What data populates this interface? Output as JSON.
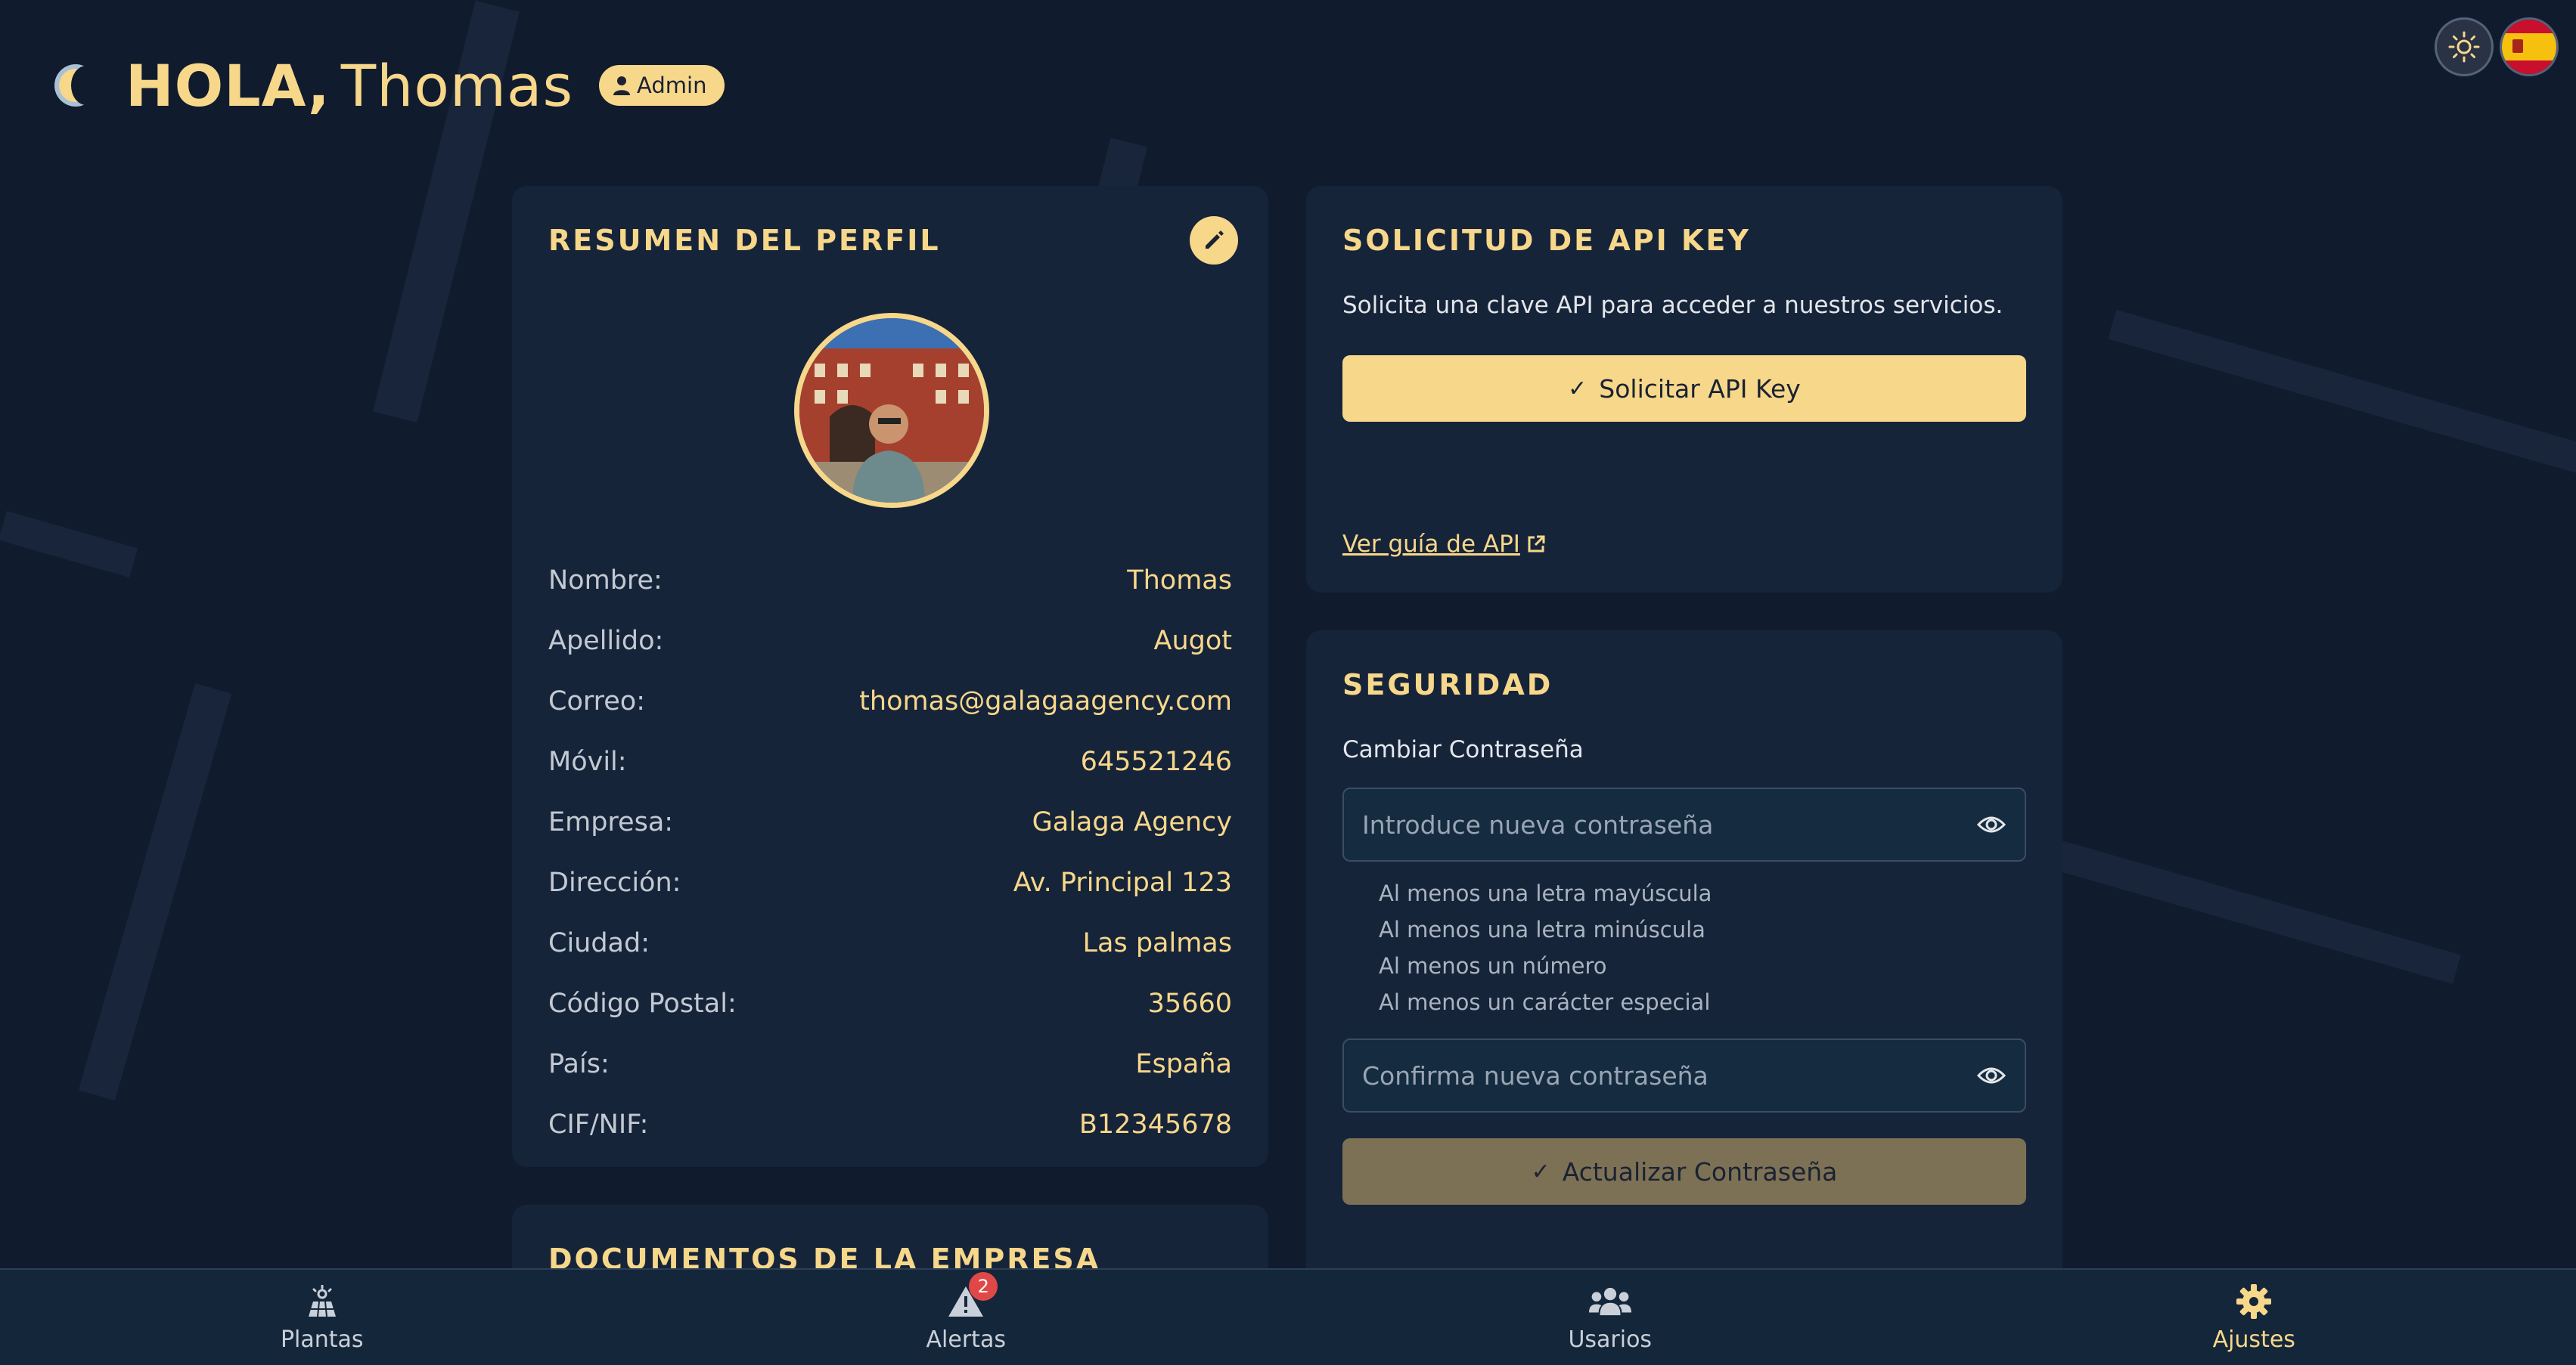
{
  "header": {
    "greeting": "HOLA,",
    "user_name": "Thomas",
    "role_badge": "Admin"
  },
  "profile": {
    "title": "RESUMEN DEL PERFIL",
    "fields": [
      {
        "label": "Nombre:",
        "value": "Thomas"
      },
      {
        "label": "Apellido:",
        "value": "Augot"
      },
      {
        "label": "Correo:",
        "value": "thomas@galagaagency.com"
      },
      {
        "label": "Móvil:",
        "value": "645521246"
      },
      {
        "label": "Empresa:",
        "value": "Galaga Agency"
      },
      {
        "label": "Dirección:",
        "value": "Av. Principal 123"
      },
      {
        "label": "Ciudad:",
        "value": "Las palmas"
      },
      {
        "label": "Código Postal:",
        "value": "35660"
      },
      {
        "label": "País:",
        "value": "España"
      },
      {
        "label": "CIF/NIF:",
        "value": "B12345678"
      }
    ]
  },
  "documents": {
    "title": "DOCUMENTOS DE LA EMPRESA"
  },
  "api": {
    "title": "SOLICITUD DE API KEY",
    "description": "Solicita una clave API para acceder a nuestros servicios.",
    "button_label": "Solicitar API Key",
    "guide_link": "Ver guía de API"
  },
  "security": {
    "title": "SEGURIDAD",
    "subtitle": "Cambiar Contraseña",
    "new_password_placeholder": "Introduce nueva contraseña",
    "confirm_password_placeholder": "Confirma nueva contraseña",
    "rules": [
      "Al menos una letra mayúscula",
      "Al menos una letra minúscula",
      "Al menos un número",
      "Al menos un carácter especial"
    ],
    "update_button_label": "Actualizar Contraseña"
  },
  "nav": {
    "items": [
      {
        "label": "Plantas",
        "icon": "solar-plant-icon"
      },
      {
        "label": "Alertas",
        "icon": "alert-icon",
        "badge": "2"
      },
      {
        "label": "Usarios",
        "icon": "users-icon"
      },
      {
        "label": "Ajustes",
        "icon": "gear-icon",
        "active": true
      }
    ]
  },
  "colors": {
    "background": "#111b2e",
    "card": "#16243a",
    "accent": "#f7d78a",
    "badge_red": "#e04848"
  }
}
